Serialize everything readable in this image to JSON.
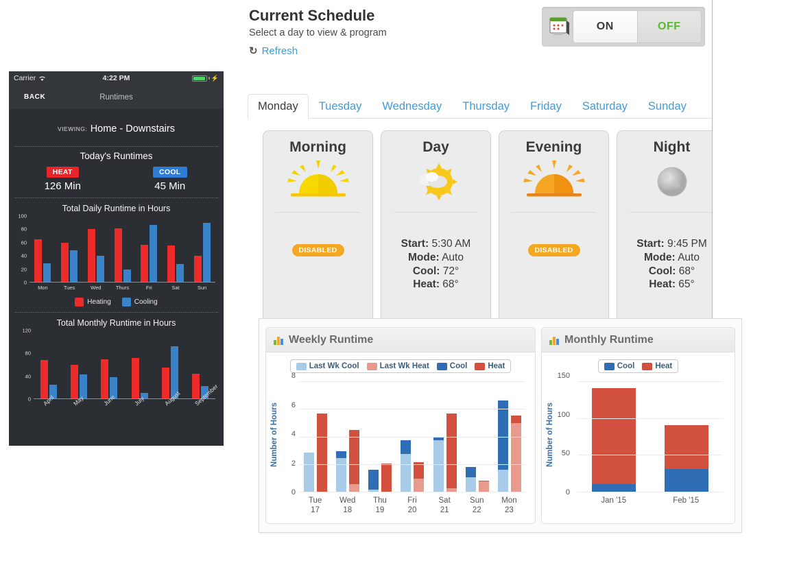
{
  "phone": {
    "status": {
      "carrier": "Carrier",
      "wifi_icon": "wifi-icon",
      "time": "4:22 PM",
      "battery_icon": "battery-charging-icon"
    },
    "nav": {
      "back": "BACK",
      "title": "Runtimes"
    },
    "viewing": {
      "label": "VIEWING:",
      "value": "Home - Downstairs"
    },
    "today": {
      "title": "Today's Runtimes",
      "heat_label": "HEAT",
      "heat_value": "126 Min",
      "cool_label": "COOL",
      "cool_value": "45 Min"
    },
    "daily_chart_title": "Total Daily Runtime in Hours",
    "monthly_chart_title": "Total Monthly Runtime in Hours",
    "legend": {
      "heating": "Heating",
      "cooling": "Cooling"
    },
    "colors": {
      "heat": "#ee2b2b",
      "cool": "#3b83c8",
      "bg": "#2b2f33"
    }
  },
  "schedule": {
    "title": "Current Schedule",
    "subtitle": "Select a day to view & program",
    "refresh": "Refresh",
    "refresh_icon": "refresh-icon",
    "schedule_icon": "calendar-icon",
    "toggle": {
      "on": "ON",
      "off": "OFF",
      "selected": "ON",
      "off_color": "#56ba2d"
    },
    "tabs": [
      {
        "label": "Monday",
        "active": true
      },
      {
        "label": "Tuesday",
        "active": false
      },
      {
        "label": "Wednesday",
        "active": false
      },
      {
        "label": "Thursday",
        "active": false
      },
      {
        "label": "Friday",
        "active": false
      },
      {
        "label": "Saturday",
        "active": false
      },
      {
        "label": "Sunday",
        "active": false
      }
    ],
    "periods": [
      {
        "name": "Morning",
        "icon": "sunrise-icon",
        "status": "DISABLED",
        "enabled": false,
        "start_label": "Start:",
        "start": "",
        "mode_label": "Mode:",
        "mode": "",
        "cool_label": "Cool:",
        "cool": "",
        "heat_label": "Heat:",
        "heat": ""
      },
      {
        "name": "Day",
        "icon": "sun-cloud-icon",
        "status": "",
        "enabled": true,
        "start_label": "Start:",
        "start": "5:30 AM",
        "mode_label": "Mode:",
        "mode": "Auto",
        "cool_label": "Cool:",
        "cool": "72°",
        "heat_label": "Heat:",
        "heat": "68°"
      },
      {
        "name": "Evening",
        "icon": "sunset-icon",
        "status": "DISABLED",
        "enabled": false,
        "start_label": "Start:",
        "start": "",
        "mode_label": "Mode:",
        "mode": "",
        "cool_label": "Cool:",
        "cool": "",
        "heat_label": "Heat:",
        "heat": ""
      },
      {
        "name": "Night",
        "icon": "moon-icon",
        "status": "",
        "enabled": true,
        "start_label": "Start:",
        "start": "9:45 PM",
        "mode_label": "Mode:",
        "mode": "Auto",
        "cool_label": "Cool:",
        "cool": "68°",
        "heat_label": "Heat:",
        "heat": "65°"
      }
    ],
    "disabled_badge_color": "#f5a623"
  },
  "panels": {
    "weekly_title": "Weekly Runtime",
    "monthly_title": "Monthly Runtime",
    "chart_icon": "bar-chart-icon"
  },
  "chart_data": [
    {
      "id": "phone_daily",
      "type": "bar",
      "title": "Total Daily Runtime in Hours",
      "xlabel": "",
      "ylabel": "",
      "categories": [
        "Mon",
        "Tues",
        "Wed",
        "Thurs",
        "Fri",
        "Sat",
        "Sun"
      ],
      "series": [
        {
          "name": "Heating",
          "color": "#ee2b2b",
          "values": [
            65,
            59,
            80,
            81,
            56,
            55,
            40
          ]
        },
        {
          "name": "Cooling",
          "color": "#3b83c8",
          "values": [
            28,
            48,
            40,
            19,
            86,
            27,
            90
          ]
        }
      ],
      "ylim": [
        0,
        100
      ],
      "yticks": [
        0,
        20,
        40,
        60,
        80,
        100
      ],
      "legend": [
        "Heating",
        "Cooling"
      ],
      "legend_position": "bottom",
      "grid": false
    },
    {
      "id": "phone_monthly",
      "type": "bar",
      "title": "Total Monthly Runtime in Hours",
      "xlabel": "",
      "ylabel": "",
      "categories": [
        "April",
        "May",
        "June",
        "July",
        "August",
        "September"
      ],
      "series": [
        {
          "name": "Heating",
          "color": "#ee2b2b",
          "values": [
            68,
            59,
            69,
            71,
            54,
            44
          ]
        },
        {
          "name": "Cooling",
          "color": "#3b83c8",
          "values": [
            24,
            43,
            38,
            10,
            92,
            22
          ]
        }
      ],
      "ylim": [
        0,
        120
      ],
      "yticks": [
        0,
        40,
        80,
        120
      ],
      "grid": false
    },
    {
      "id": "weekly_runtime",
      "type": "bar",
      "stacked": true,
      "title": "Weekly Runtime",
      "xlabel": "",
      "ylabel": "Number of Hours",
      "categories": [
        "Tue 17",
        "Wed 18",
        "Thu 19",
        "Fri 20",
        "Sat 21",
        "Sun 22",
        "Mon 23"
      ],
      "category_lines": [
        [
          "Tue",
          "17"
        ],
        [
          "Wed",
          "18"
        ],
        [
          "Thu",
          "19"
        ],
        [
          "Fri",
          "20"
        ],
        [
          "Sat",
          "21"
        ],
        [
          "Sun",
          "22"
        ],
        [
          "Mon",
          "23"
        ]
      ],
      "series": [
        {
          "name": "Last Wk Cool",
          "color": "#a8cbe8",
          "stack": "cool",
          "values": [
            2.85,
            2.45,
            0.15,
            2.75,
            3.75,
            1.05,
            1.6
          ]
        },
        {
          "name": "Cool",
          "color": "#2f6eb5",
          "stack": "cool",
          "values": [
            0,
            0.5,
            1.45,
            1.0,
            0.25,
            0.75,
            5.0
          ]
        },
        {
          "name": "Last Wk Heat",
          "color": "#e89a8c",
          "stack": "heat",
          "values": [
            0,
            0.55,
            0,
            0.95,
            0.25,
            0.75,
            4.95
          ]
        },
        {
          "name": "Heat",
          "color": "#d1503e",
          "stack": "heat",
          "values": [
            5.65,
            3.9,
            2.05,
            1.2,
            5.4,
            0.05,
            0.55
          ]
        }
      ],
      "ylim": [
        0,
        8
      ],
      "yticks": [
        0,
        2,
        4,
        6,
        8
      ],
      "legend": [
        "Last Wk Cool",
        "Last Wk Heat",
        "Cool",
        "Heat"
      ],
      "legend_position": "top",
      "grid": true
    },
    {
      "id": "monthly_runtime",
      "type": "bar",
      "stacked": true,
      "title": "Monthly Runtime",
      "xlabel": "",
      "ylabel": "Number of Hours",
      "categories": [
        "Jan '15",
        "Feb '15"
      ],
      "series": [
        {
          "name": "Heat",
          "color": "#d1503e",
          "values": [
            131,
            59
          ]
        },
        {
          "name": "Cool",
          "color": "#2f6eb5",
          "values": [
            10,
            31
          ]
        }
      ],
      "ylim": [
        0,
        150
      ],
      "yticks": [
        0,
        50,
        100,
        150
      ],
      "legend": [
        "Cool",
        "Heat"
      ],
      "legend_position": "top",
      "grid": true
    }
  ]
}
